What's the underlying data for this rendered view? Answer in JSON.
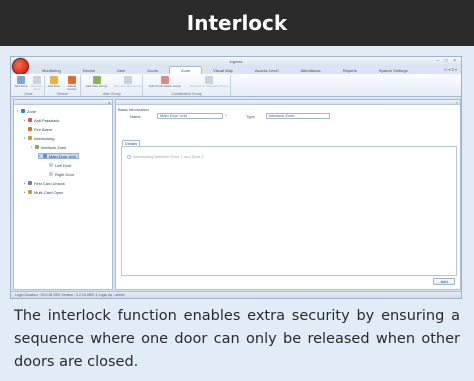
{
  "header": {
    "title": "Interlock"
  },
  "app": {
    "title": "Ingress",
    "menu": [
      "Monitoring",
      "Device",
      "User",
      "Doors",
      "Zone",
      "Visual Map",
      "Access Level",
      "Attendance",
      "Reports",
      "System Settings"
    ],
    "active_menu": "Zone",
    "menu_right": "⊖ ▾ ⍰ ▾",
    "window_controls": "– □ ×"
  },
  "ribbon": {
    "groups": [
      {
        "label": "Zone",
        "buttons": [
          "Add Zone",
          "Remove Zone"
        ]
      },
      {
        "label": "Device",
        "buttons": [
          "Add Door",
          "Delete Device"
        ]
      },
      {
        "label": "User Group",
        "buttons": [
          "Add User Group",
          "Remove User Group"
        ]
      },
      {
        "label": "Combination Group",
        "buttons": [
          "Add Combination Group",
          "Remove Combination Group"
        ]
      }
    ]
  },
  "tree": {
    "pin": "◂",
    "items": [
      {
        "label": "Zone",
        "level": 0,
        "toggle": "▾",
        "color": "#3a78c9"
      },
      {
        "label": "Anti Passback",
        "level": 1,
        "toggle": "▸",
        "color": "#d9534f"
      },
      {
        "label": "Fire Alarm",
        "level": 1,
        "toggle": "",
        "color": "#e06b2c"
      },
      {
        "label": "Interlocking",
        "level": 1,
        "toggle": "▾",
        "color": "#b9a23a"
      },
      {
        "label": "Interlock Zone",
        "level": 2,
        "toggle": "▾",
        "color": "#8aa85a"
      },
      {
        "label": "Main Door Unit",
        "level": 3,
        "toggle": "▾",
        "color": "#5c8ed1",
        "selected": true
      },
      {
        "label": "Left Door",
        "level": 4,
        "toggle": "",
        "color": "#c8cfd8"
      },
      {
        "label": "Right Door",
        "level": 4,
        "toggle": "",
        "color": "#c8cfd8"
      },
      {
        "label": "First Card Unlock",
        "level": 1,
        "toggle": "▸",
        "color": "#6a7f98"
      },
      {
        "label": "Multi-Card Open",
        "level": 1,
        "toggle": "▸",
        "color": "#b9a23a"
      }
    ]
  },
  "detail": {
    "section_label": "Basic Information",
    "name_label": "Name",
    "name_value": "Main Door Unit",
    "type_label": "Type",
    "type_value": "Interlock Zone",
    "tab_label": "Details",
    "radio_label": "Interlocking between Door 1 and Door 2",
    "add_label": "Add"
  },
  "status": {
    "text": "Login Duration : 00:0:38    SDK Version : 0.2.16.0807-1    Login As : admin"
  },
  "caption": {
    "text": "The interlock function enables extra security by ensuring a sequence where one door can only be released when other doors are closed."
  }
}
